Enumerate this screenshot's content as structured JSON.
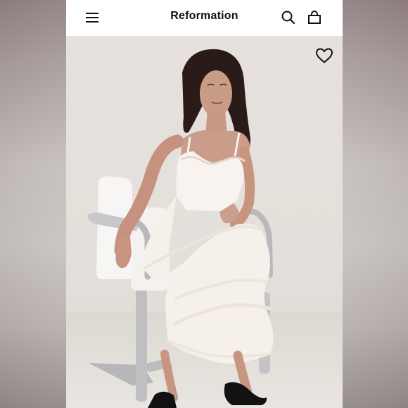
{
  "header": {
    "brand": "Reformation",
    "icons": {
      "menu": "menu-icon",
      "search": "search-icon",
      "bag": "shopping-bag-icon"
    }
  },
  "product_image": {
    "favorite_icon": "heart-icon",
    "colors": {
      "dress": "#f5efe9",
      "backdrop": "#e4dfda",
      "chair_chrome": "#b9b8b9"
    }
  }
}
